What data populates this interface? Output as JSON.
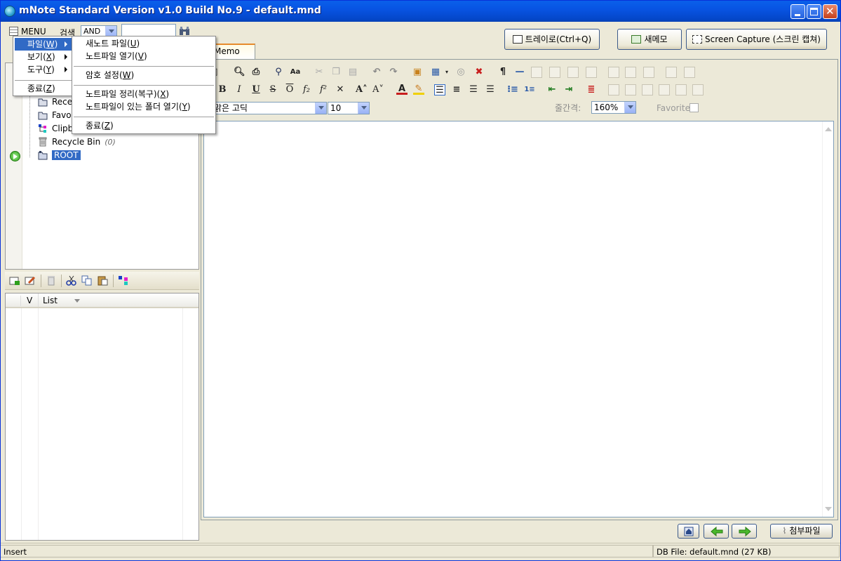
{
  "window": {
    "title": "mNote Standard Version v1.0 Build No.9 - default.mnd"
  },
  "toolbar": {
    "menu_label": "MENU",
    "search_label": "검색",
    "search_operator": "AND",
    "search_value": "",
    "tray_label": "트레이로(Ctrl+Q)",
    "new_memo_label": "새메모",
    "screen_capture_label": "Screen Capture (스크린 캡쳐)"
  },
  "main_menu": {
    "items": [
      {
        "label": "파일(",
        "key": "W",
        "suffix": ")"
      },
      {
        "label": "보기(",
        "key": "X",
        "suffix": ")"
      },
      {
        "label": "도구(",
        "key": "Y",
        "suffix": ")"
      },
      {
        "label": "종료(",
        "key": "Z",
        "suffix": ")"
      }
    ]
  },
  "file_menu": {
    "items": [
      {
        "label": "새노트 파일(",
        "key": "U",
        "suffix": ")"
      },
      {
        "label": "노트파일 열기(",
        "key": "V",
        "suffix": ")"
      },
      {
        "label": "암호 설정(",
        "key": "W",
        "suffix": ")"
      },
      {
        "label": "노트파일 정리(복구)(",
        "key": "X",
        "suffix": ")"
      },
      {
        "label": "노트파일이 있는 폴더 열기(",
        "key": "Y",
        "suffix": ")"
      },
      {
        "label": "종료(",
        "key": "Z",
        "suffix": ")"
      }
    ]
  },
  "tree": {
    "items": [
      {
        "label": "Rece"
      },
      {
        "label": "Favo"
      },
      {
        "label": "Clipb"
      },
      {
        "label": "Recycle Bin",
        "count": "(0)"
      },
      {
        "label": "ROOT"
      }
    ]
  },
  "list": {
    "col_v": "V",
    "col_list": "List"
  },
  "editor": {
    "tab_label": "Memo",
    "font_name": "맑은 고딕",
    "font_size": "10",
    "line_spacing_label": "줄간격:",
    "line_spacing_value": "160%",
    "favorite_label": "Favorite",
    "attach_label": "첨부파일"
  },
  "status": {
    "mode": "Insert",
    "db_file": "DB File: default.mnd (27 KB)"
  }
}
